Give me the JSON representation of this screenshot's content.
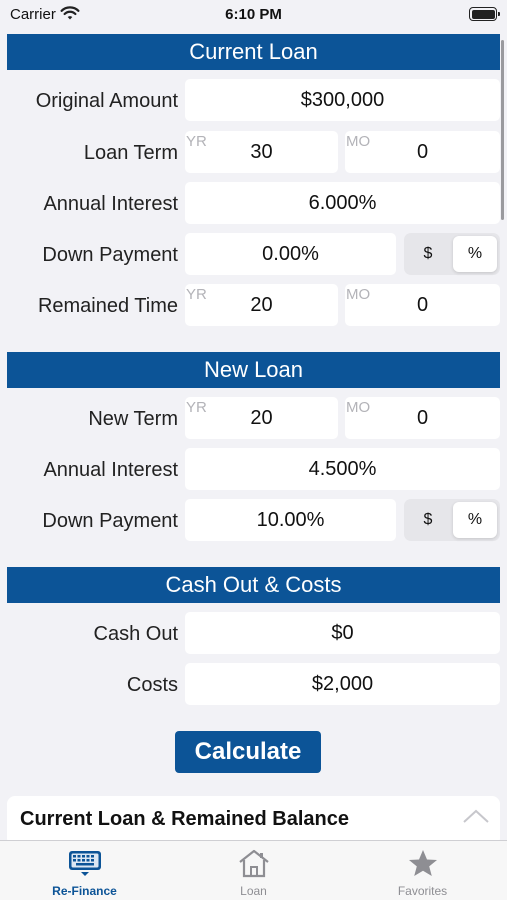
{
  "status_bar": {
    "carrier": "Carrier",
    "time": "6:10 PM"
  },
  "current_loan": {
    "header": "Current Loan",
    "original_amount": {
      "label": "Original Amount",
      "value": "$300,000"
    },
    "loan_term": {
      "label": "Loan Term",
      "yr_unit": "YR",
      "years": "30",
      "mo_unit": "MO",
      "months": "0"
    },
    "annual_interest": {
      "label": "Annual Interest",
      "value": "6.000%"
    },
    "down_payment": {
      "label": "Down Payment",
      "value": "0.00%",
      "seg_dollar": "$",
      "seg_percent": "%",
      "selected": "%"
    },
    "remained_time": {
      "label": "Remained Time",
      "yr_unit": "YR",
      "years": "20",
      "mo_unit": "MO",
      "months": "0"
    }
  },
  "new_loan": {
    "header": "New Loan",
    "new_term": {
      "label": "New Term",
      "yr_unit": "YR",
      "years": "20",
      "mo_unit": "MO",
      "months": "0"
    },
    "annual_interest": {
      "label": "Annual Interest",
      "value": "4.500%"
    },
    "down_payment": {
      "label": "Down Payment",
      "value": "10.00%",
      "seg_dollar": "$",
      "seg_percent": "%",
      "selected": "%"
    }
  },
  "cash_out_costs": {
    "header": "Cash Out & Costs",
    "cash_out": {
      "label": "Cash Out",
      "value": "$0"
    },
    "costs": {
      "label": "Costs",
      "value": "$2,000"
    }
  },
  "calculate_label": "Calculate",
  "results": {
    "title": "Current Loan & Remained Balance"
  },
  "tabs": [
    {
      "label": "Re-Finance",
      "icon": "keyboard-icon",
      "active": true
    },
    {
      "label": "Loan",
      "icon": "house-icon",
      "active": false
    },
    {
      "label": "Favorites",
      "icon": "star-icon",
      "active": false
    }
  ],
  "colors": {
    "accent": "#0c5497",
    "background": "#f2f2f6",
    "inactive_tab": "#8e8e93"
  }
}
